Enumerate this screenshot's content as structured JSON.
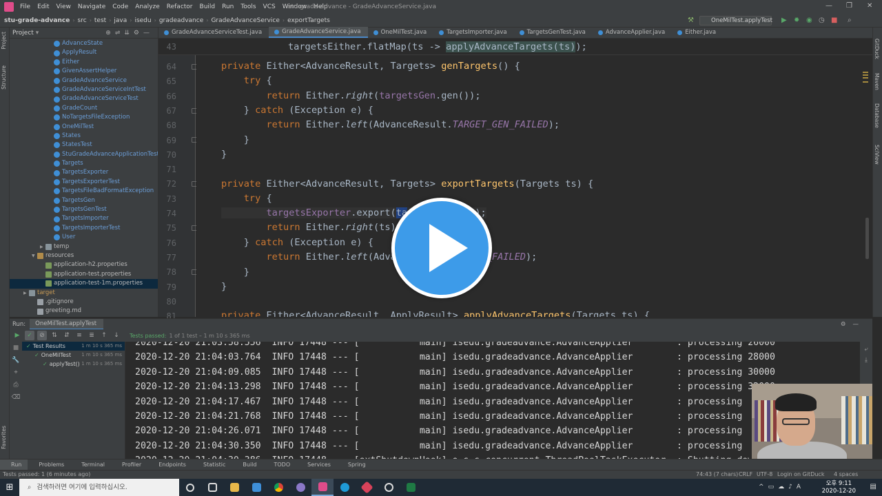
{
  "window": {
    "title": "stu-grade-advance - GradeAdvanceService.java",
    "menu": [
      "File",
      "Edit",
      "View",
      "Navigate",
      "Code",
      "Analyze",
      "Refactor",
      "Build",
      "Run",
      "Tools",
      "VCS",
      "Window",
      "Help"
    ]
  },
  "breadcrumb": [
    "stu-grade-advance",
    "src",
    "test",
    "java",
    "isedu",
    "gradeadvance",
    "GradeAdvanceService",
    "exportTargets"
  ],
  "run_config": "OneMilTest.applyTest",
  "project_panel": {
    "title": "Project",
    "items": [
      {
        "label": "AdvanceState",
        "kind": "cls",
        "indent": 3,
        "style": "blue"
      },
      {
        "label": "ApplyResult",
        "kind": "cls",
        "indent": 3,
        "style": "blue"
      },
      {
        "label": "Either",
        "kind": "cls",
        "indent": 3,
        "style": "blue"
      },
      {
        "label": "GivenAssertHelper",
        "kind": "cls",
        "indent": 3,
        "style": "blue"
      },
      {
        "label": "GradeAdvanceService",
        "kind": "cls",
        "indent": 3,
        "style": "blue"
      },
      {
        "label": "GradeAdvanceServiceIntTest",
        "kind": "cls",
        "indent": 3,
        "style": "blue"
      },
      {
        "label": "GradeAdvanceServiceTest",
        "kind": "cls",
        "indent": 3,
        "style": "blue"
      },
      {
        "label": "GradeCount",
        "kind": "cls",
        "indent": 3,
        "style": "blue"
      },
      {
        "label": "NoTargetsFileException",
        "kind": "cls",
        "indent": 3,
        "style": "blue"
      },
      {
        "label": "OneMilTest",
        "kind": "cls",
        "indent": 3,
        "style": "blue"
      },
      {
        "label": "States",
        "kind": "cls",
        "indent": 3,
        "style": "blue"
      },
      {
        "label": "StatesTest",
        "kind": "cls",
        "indent": 3,
        "style": "blue"
      },
      {
        "label": "StuGradeAdvanceApplicationTests",
        "kind": "cls",
        "indent": 3,
        "style": "blue"
      },
      {
        "label": "Targets",
        "kind": "cls",
        "indent": 3,
        "style": "blue"
      },
      {
        "label": "TargetsExporter",
        "kind": "cls",
        "indent": 3,
        "style": "blue"
      },
      {
        "label": "TargetsExporterTest",
        "kind": "cls",
        "indent": 3,
        "style": "blue"
      },
      {
        "label": "TargetsFileBadFormatException",
        "kind": "cls",
        "indent": 3,
        "style": "blue"
      },
      {
        "label": "TargetsGen",
        "kind": "cls",
        "indent": 3,
        "style": "blue"
      },
      {
        "label": "TargetsGenTest",
        "kind": "cls",
        "indent": 3,
        "style": "blue"
      },
      {
        "label": "TargetsImporter",
        "kind": "cls",
        "indent": 3,
        "style": "blue"
      },
      {
        "label": "TargetsImporterTest",
        "kind": "cls",
        "indent": 3,
        "style": "blue"
      },
      {
        "label": "User",
        "kind": "cls",
        "indent": 3,
        "style": "blue"
      },
      {
        "label": "temp",
        "kind": "folder",
        "indent": 2,
        "arrow": "▶"
      },
      {
        "label": "resources",
        "kind": "res",
        "indent": 1,
        "arrow": "▼"
      },
      {
        "label": "application-h2.properties",
        "kind": "prop",
        "indent": 2
      },
      {
        "label": "application-test.properties",
        "kind": "prop",
        "indent": 2
      },
      {
        "label": "application-test-1m.properties",
        "kind": "prop",
        "indent": 2,
        "selected": true
      },
      {
        "label": "target",
        "kind": "folder",
        "indent": 0,
        "arrow": "▶",
        "style": "brown"
      },
      {
        "label": ".gitignore",
        "kind": "file",
        "indent": 1
      },
      {
        "label": "greeting.md",
        "kind": "file",
        "indent": 1
      }
    ]
  },
  "tabs": [
    {
      "label": "GradeAdvanceServiceTest.java"
    },
    {
      "label": "GradeAdvanceService.java",
      "active": true
    },
    {
      "label": "OneMilTest.java"
    },
    {
      "label": "TargetsImporter.java"
    },
    {
      "label": "TargetsGenTest.java"
    },
    {
      "label": "AdvanceApplier.java"
    },
    {
      "label": "Either.java"
    }
  ],
  "editor": {
    "sticky_line": {
      "num": "43",
      "pre": "targetsEither.flatMap(ts -> ",
      "hl": "applyAdvanceTargets(ts)",
      "post": ");"
    },
    "line_numbers": [
      "64",
      "65",
      "66",
      "67",
      "68",
      "69",
      "70",
      "71",
      "72",
      "73",
      "74",
      "75",
      "76",
      "77",
      "78",
      "79",
      "80",
      "81"
    ]
  },
  "run_panel": {
    "label": "Run:",
    "tab": "OneMilTest.applyTest",
    "status": "Tests passed:",
    "status_count": "1 of 1 test – 1 m 10 s 365 ms",
    "tree": [
      {
        "label": "Test Results",
        "time": "1 m 10 s 365 ms",
        "indent": 0
      },
      {
        "label": "OneMilTest",
        "time": "1 m 10 s 365 ms",
        "indent": 1
      },
      {
        "label": "applyTest()",
        "time": "1 m 10 s 365 ms",
        "indent": 2
      }
    ],
    "log": [
      "2020-12-20 21:03:58.556  INFO 17448 --- [           main] isedu.gradeadvance.AdvanceApplier        : processing 26000",
      "2020-12-20 21:04:03.764  INFO 17448 --- [           main] isedu.gradeadvance.AdvanceApplier        : processing 28000",
      "2020-12-20 21:04:09.085  INFO 17448 --- [           main] isedu.gradeadvance.AdvanceApplier        : processing 30000",
      "2020-12-20 21:04:13.298  INFO 17448 --- [           main] isedu.gradeadvance.AdvanceApplier        : processing 32000",
      "2020-12-20 21:04:17.467  INFO 17448 --- [           main] isedu.gradeadvance.AdvanceApplier        : processing",
      "2020-12-20 21:04:21.768  INFO 17448 --- [           main] isedu.gradeadvance.AdvanceApplier        : processing",
      "2020-12-20 21:04:26.071  INFO 17448 --- [           main] isedu.gradeadvance.AdvanceApplier        : processing",
      "2020-12-20 21:04:30.350  INFO 17448 --- [           main] isedu.gradeadvance.AdvanceApplier        : processing",
      "2020-12-20 21:04:30.386  INFO 17448 --- [extShutdownHook] o.s.s.concurrent.ThreadPoolTaskExecutor  : Shutting down"
    ]
  },
  "bottom_tabs": [
    "Run",
    "Problems",
    "Terminal",
    "Profiler",
    "Endpoints",
    "Statistic",
    "Build",
    "TODO",
    "Services",
    "Spring"
  ],
  "status_bar": {
    "left": "Tests passed: 1 (6 minutes ago)",
    "position": "74:43 (7 chars)",
    "line_sep": "CRLF",
    "encoding": "UTF-8",
    "vcs": "Login on GitDuck",
    "indent": "4 spaces"
  },
  "side_labels": {
    "left": [
      "Project",
      "Structure",
      "Favorites"
    ],
    "right": [
      "GitDuck",
      "Maven",
      "Database",
      "SciView"
    ]
  },
  "taskbar": {
    "search_placeholder": "검색하려면 여기에 입력하십시오.",
    "clock_ampm": "오후 9:11",
    "clock_date": "2020-12-20"
  },
  "colors": {
    "accent": "#3d9be9",
    "keyword": "#cc7832",
    "method": "#ffc66d",
    "field": "#9876aa",
    "pass": "#59a869"
  }
}
